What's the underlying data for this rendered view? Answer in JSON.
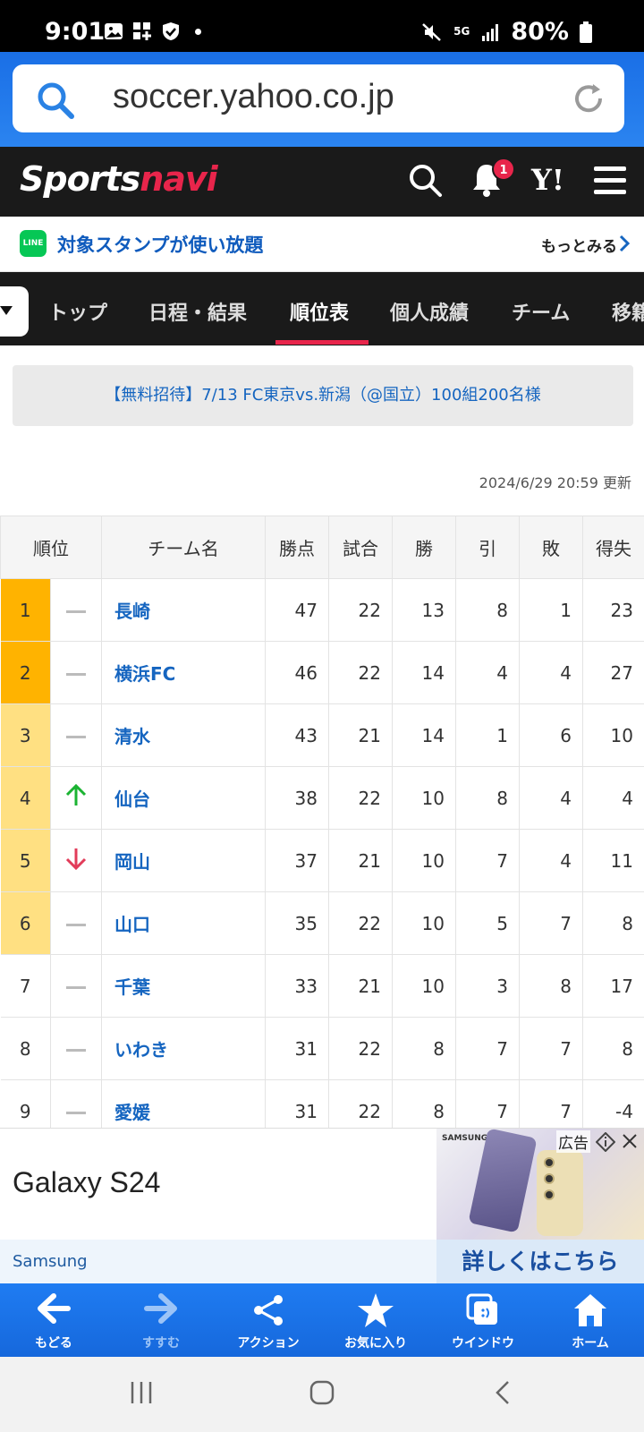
{
  "status_bar": {
    "time": "9:01",
    "network": "5G",
    "battery": "80%"
  },
  "browser": {
    "url": "soccer.yahoo.co.jp"
  },
  "header": {
    "logo_part1": "Sports",
    "logo_part2": "navi",
    "notification_count": "1",
    "yahoo_label": "Y!"
  },
  "promo": {
    "text": "対象スタンプが使い放題",
    "more": "もっとみる",
    "line_label": "LINE"
  },
  "tabs": [
    {
      "label": "トップ"
    },
    {
      "label": "日程・結果"
    },
    {
      "label": "順位表",
      "active": true
    },
    {
      "label": "個人成績"
    },
    {
      "label": "チーム"
    },
    {
      "label": "移籍"
    }
  ],
  "banner": {
    "text": "【無料招待】7/13 FC東京vs.新潟（@国立）100組200名様"
  },
  "updated": "2024/6/29 20:59 更新",
  "standings": {
    "headers": [
      "順位",
      "チーム名",
      "勝点",
      "試合",
      "勝",
      "引",
      "敗",
      "得失"
    ],
    "rows": [
      {
        "rank": "1",
        "change": "same",
        "team": "長崎",
        "pts": "47",
        "played": "22",
        "w": "13",
        "d": "8",
        "l": "1",
        "gd": "23"
      },
      {
        "rank": "2",
        "change": "same",
        "team": "横浜FC",
        "pts": "46",
        "played": "22",
        "w": "14",
        "d": "4",
        "l": "4",
        "gd": "27"
      },
      {
        "rank": "3",
        "change": "same",
        "team": "清水",
        "pts": "43",
        "played": "21",
        "w": "14",
        "d": "1",
        "l": "6",
        "gd": "10"
      },
      {
        "rank": "4",
        "change": "up",
        "team": "仙台",
        "pts": "38",
        "played": "22",
        "w": "10",
        "d": "8",
        "l": "4",
        "gd": "4"
      },
      {
        "rank": "5",
        "change": "down",
        "team": "岡山",
        "pts": "37",
        "played": "21",
        "w": "10",
        "d": "7",
        "l": "4",
        "gd": "11"
      },
      {
        "rank": "6",
        "change": "same",
        "team": "山口",
        "pts": "35",
        "played": "22",
        "w": "10",
        "d": "5",
        "l": "7",
        "gd": "8"
      },
      {
        "rank": "7",
        "change": "same",
        "team": "千葉",
        "pts": "33",
        "played": "21",
        "w": "10",
        "d": "3",
        "l": "8",
        "gd": "17"
      },
      {
        "rank": "8",
        "change": "same",
        "team": "いわき",
        "pts": "31",
        "played": "22",
        "w": "8",
        "d": "7",
        "l": "7",
        "gd": "8"
      },
      {
        "rank": "9",
        "change": "same",
        "team": "愛媛",
        "pts": "31",
        "played": "22",
        "w": "8",
        "d": "7",
        "l": "7",
        "gd": "-4"
      }
    ]
  },
  "ad": {
    "title": "Galaxy S24",
    "brand_on_image": "SAMSUNG",
    "label": "広告",
    "sponsor": "Samsung",
    "cta": "詳しくはこちら"
  },
  "toolbar": [
    {
      "label": "もどる",
      "icon": "back-arrow-icon"
    },
    {
      "label": "すすむ",
      "icon": "forward-arrow-icon",
      "disabled": true
    },
    {
      "label": "アクション",
      "icon": "share-icon"
    },
    {
      "label": "お気に入り",
      "icon": "star-icon"
    },
    {
      "label": "ウインドウ",
      "icon": "window-icon"
    },
    {
      "label": "ホーム",
      "icon": "home-icon"
    }
  ],
  "colors": {
    "brand_red": "#e8254b",
    "link_blue": "#1565c0",
    "toolbar_blue": "#1f7cf2"
  }
}
